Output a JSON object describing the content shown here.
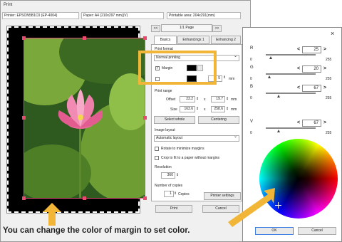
{
  "print_window": {
    "title": "Print",
    "printer": "Printer: EPSON5B1C0 (EP-4004)",
    "paper": "Paper: A4 (210x297 mm)(V)",
    "printable_area": "Printable area: 204x291(mm)",
    "page_indicator": "1/1 Page",
    "nav_prev": "<<",
    "nav_next": ">>"
  },
  "tabs": [
    "Basics",
    "Enhancings 1",
    "Enhancing 2"
  ],
  "basics": {
    "print_format_label": "Print format",
    "print_format_value": "Normal printing",
    "margin_label": "Margin",
    "margin_checked": true,
    "margin_color": "#000000",
    "line_value": "5",
    "line_unit": "mm",
    "print_range_label": "Print range",
    "offset_label": "Offset",
    "offset_x": "23.2",
    "offset_y": "19.7",
    "offset_unit": "mm",
    "size_label": "Size",
    "size_w": "163.6",
    "size_h": "258.6",
    "size_unit": "mm",
    "x_sep": "x",
    "select_whole": "Select whole",
    "centering": "Centering",
    "image_layout_label": "Image layout",
    "image_layout_value": "Automatic layout",
    "rotate_label": "Rotate to minimize margins",
    "crop_label": "Crop to fit to a paper without margins",
    "resolution_label": "Resolution",
    "resolution_value": "360",
    "copies_label": "Number of copies",
    "copies_value": "1",
    "copies_unit": "Copies",
    "printer_settings": "Printer settings",
    "print_button": "Print",
    "cancel_button": "Cancel"
  },
  "color_dialog": {
    "close": "×",
    "channels": [
      {
        "name": "R",
        "value": "25",
        "level": 0.098
      },
      {
        "name": "G",
        "value": "20",
        "level": 0.078
      },
      {
        "name": "B",
        "value": "67",
        "level": 0.263
      }
    ],
    "v_channel": {
      "name": "V",
      "value": "67",
      "level": 0.263
    },
    "min": "0",
    "max": "255",
    "ok": "OK",
    "cancel": "Cancel"
  },
  "caption": "You can change the color of margin to set color.",
  "colors": {
    "highlight": "#f1b638",
    "selection": "#e94a6e"
  }
}
